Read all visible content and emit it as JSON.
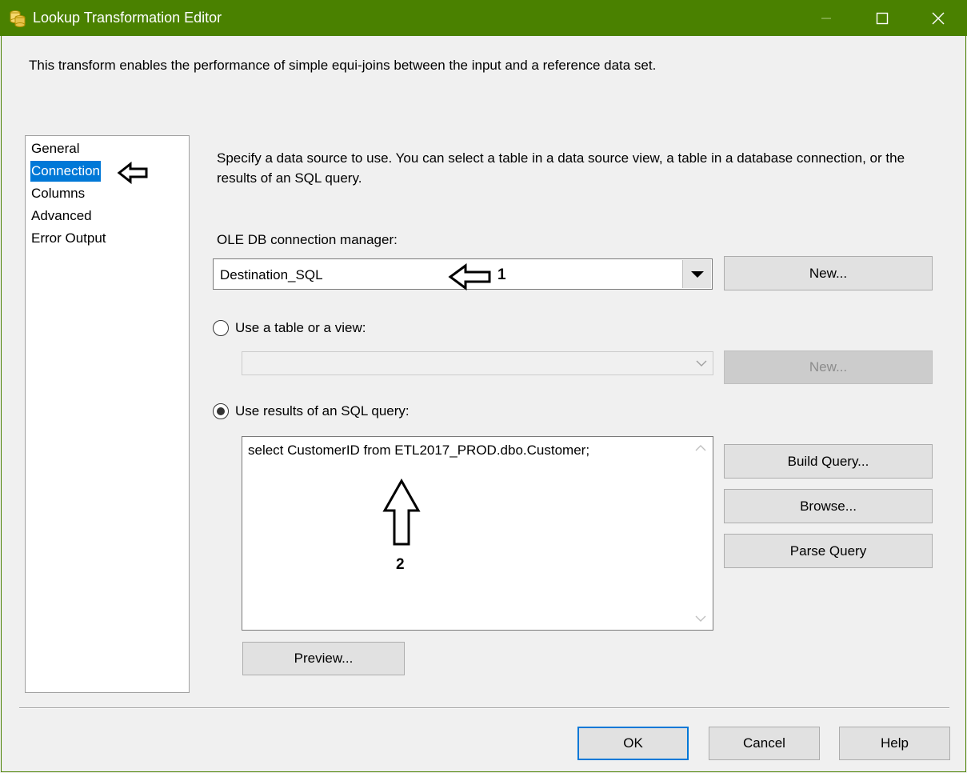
{
  "window": {
    "title": "Lookup Transformation Editor",
    "app_icon": "database-cylinders-icon",
    "controls": [
      "minimize-icon",
      "maximize-icon",
      "close-icon"
    ],
    "accent_color": "#4a8100"
  },
  "description": "This transform enables the performance of simple equi-joins between the input and a reference data set.",
  "nav": {
    "items": [
      {
        "label": "General",
        "selected": false
      },
      {
        "label": "Connection",
        "selected": true
      },
      {
        "label": "Columns",
        "selected": false
      },
      {
        "label": "Advanced",
        "selected": false
      },
      {
        "label": "Error Output",
        "selected": false
      }
    ]
  },
  "panel": {
    "intro_line1": "Specify a data source to use. You can select a table in a data source view, a table in a database connection, or the",
    "intro_line2": "results of an SQL query.",
    "connection_label": "OLE DB connection manager:",
    "connection_value": "Destination_SQL",
    "new_connection_button": "New...",
    "table_option": {
      "label": "Use a table or a view:",
      "selected": false,
      "value": ""
    },
    "new_table_button": "New...",
    "sql_option": {
      "label": "Use results of an SQL query:",
      "selected": true
    },
    "sql_query": "select CustomerID from ETL2017_PROD.dbo.Customer;",
    "side_buttons": {
      "build_query": "Build Query...",
      "browse": "Browse...",
      "parse_query": "Parse Query"
    },
    "preview_button": "Preview..."
  },
  "annotations": {
    "arrow1_label": "1",
    "arrow2_label": "2"
  },
  "footer": {
    "ok": "OK",
    "cancel": "Cancel",
    "help": "Help"
  }
}
